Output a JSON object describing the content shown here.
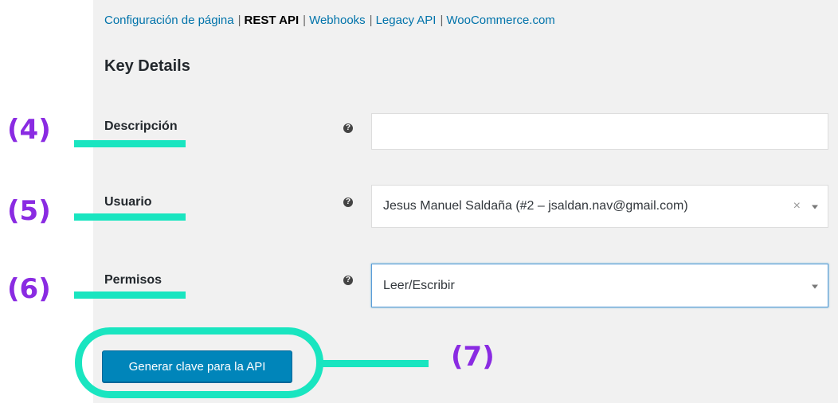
{
  "subnav": {
    "items": [
      {
        "label": "Configuración de página",
        "current": false
      },
      {
        "label": "REST API",
        "current": true
      },
      {
        "label": "Webhooks",
        "current": false
      },
      {
        "label": "Legacy API",
        "current": false
      },
      {
        "label": "WooCommerce.com",
        "current": false
      }
    ],
    "separator": "|"
  },
  "section": {
    "title": "Key Details"
  },
  "form": {
    "help_glyph": "?",
    "description": {
      "label": "Descripción",
      "value": ""
    },
    "user": {
      "label": "Usuario",
      "value": "Jesus Manuel Saldaña (#2 – jsaldan.nav@gmail.com)",
      "clear": "×"
    },
    "permissions": {
      "label": "Permisos",
      "value": "Leer/Escribir"
    },
    "submit_label": "Generar clave para la API"
  },
  "annotations": {
    "labels": [
      "(4)",
      "(5)",
      "(6)",
      "(7)"
    ],
    "color_number": "#8a2be2",
    "color_marker": "#19e5c0"
  },
  "colors": {
    "primary_button": "#0085ba",
    "link": "#0073aa"
  }
}
